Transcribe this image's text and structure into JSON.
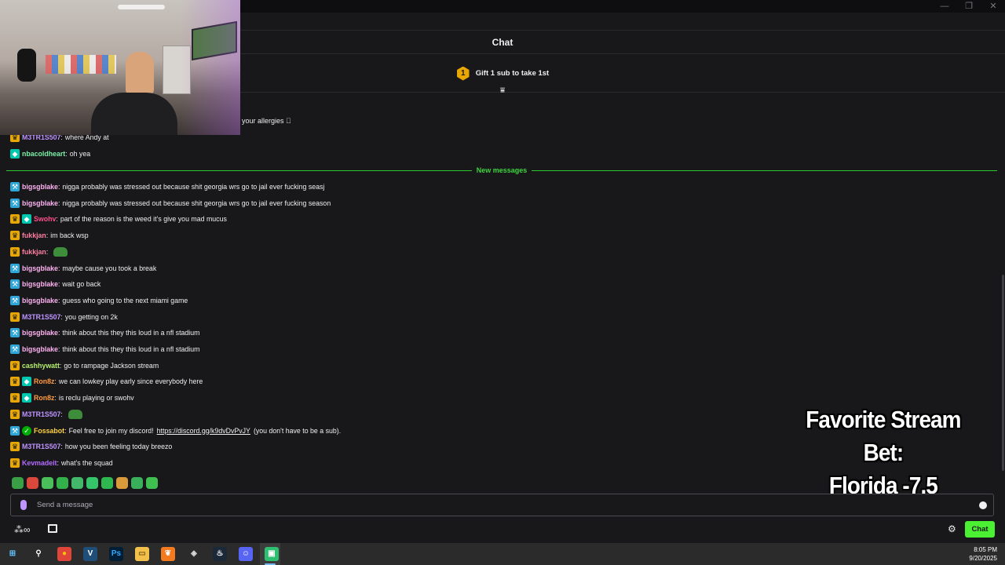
{
  "window": {
    "controls": [
      "—",
      "❐",
      "✕"
    ]
  },
  "header": {
    "title": "Chat"
  },
  "gift": {
    "rank": "1",
    "text": "Gift 1 sub to take 1st"
  },
  "partial_message": "your allergies 🏻",
  "messages_before": [
    {
      "badges": [
        "crown"
      ],
      "user": "M3TR1S507",
      "color": "#bf94ff",
      "text": "where Andy at"
    },
    {
      "badges": [
        "vip"
      ],
      "user": "nbacoldheart",
      "color": "#7bf2a6",
      "text": "oh yea"
    }
  ],
  "new_messages_label": "New messages",
  "messages": [
    {
      "badges": [
        "mod"
      ],
      "user": "bigsgblake",
      "color": "#ffb3f2",
      "text": "nigga probably was stressed out because shit georgia wrs go to jail ever fucking seasj"
    },
    {
      "badges": [
        "mod"
      ],
      "user": "bigsgblake",
      "color": "#ffb3f2",
      "text": "nigga probably was stressed out because shit georgia wrs go to jail ever fucking season"
    },
    {
      "badges": [
        "crown",
        "vip"
      ],
      "user": "Swohv",
      "color": "#ff4f8b",
      "text": "part of the reason is the weed it’s give you mad mucus"
    },
    {
      "badges": [
        "crown"
      ],
      "user": "fukkjan",
      "color": "#ff7fa1",
      "text": "im back wsp"
    },
    {
      "badges": [
        "crown"
      ],
      "user": "fukkjan",
      "color": "#ff7fa1",
      "text": "",
      "emote": "pepe-emote"
    },
    {
      "badges": [
        "mod"
      ],
      "user": "bigsgblake",
      "color": "#ffb3f2",
      "text": "maybe cause you took a break"
    },
    {
      "badges": [
        "mod"
      ],
      "user": "bigsgblake",
      "color": "#ffb3f2",
      "text": "wait go back"
    },
    {
      "badges": [
        "mod"
      ],
      "user": "bigsgblake",
      "color": "#ffb3f2",
      "text": "guess who going to the next miami game"
    },
    {
      "badges": [
        "crown"
      ],
      "user": "M3TR1S507",
      "color": "#bf94ff",
      "text": "you getting on 2k"
    },
    {
      "badges": [
        "mod"
      ],
      "user": "bigsgblake",
      "color": "#ffb3f2",
      "text": "think about this they this loud in a nfl stadium"
    },
    {
      "badges": [
        "mod"
      ],
      "user": "bigsgblake",
      "color": "#ffb3f2",
      "text": "think about this they this loud in a nfl stadium"
    },
    {
      "badges": [
        "crown"
      ],
      "user": "cashhywatt",
      "color": "#b6f06d",
      "text": "go to rampage Jackson stream"
    },
    {
      "badges": [
        "crown",
        "vip"
      ],
      "user": "Ron8z",
      "color": "#ff9b3d",
      "text": "we can lowkey play early since everybody here"
    },
    {
      "badges": [
        "crown",
        "vip"
      ],
      "user": "Ron8z",
      "color": "#ff9b3d",
      "text": "is reclu playing or swohv"
    },
    {
      "badges": [
        "crown"
      ],
      "user": "M3TR1S507",
      "color": "#bf94ff",
      "text": "",
      "emote": "gator-emote"
    },
    {
      "badges": [
        "mod",
        "verified"
      ],
      "user": "Fossabot",
      "color": "#ffd23f",
      "text": "Feel free to join my discord!",
      "link": "https://discord.gg/k9dvDvPvJY",
      "tail": "(you don't have to be a sub)."
    },
    {
      "badges": [
        "crown"
      ],
      "user": "M3TR1S507",
      "color": "#bf94ff",
      "text": "how you been feeling today breezo"
    },
    {
      "badges": [
        "crown"
      ],
      "user": "Kevmadeit",
      "color": "#b56bff",
      "text": "what's the squad"
    }
  ],
  "overlay": {
    "line1": "Favorite Stream Bet:",
    "line2": "Florida -7.5"
  },
  "input": {
    "placeholder": "Send a message"
  },
  "chat_button": "Chat",
  "emote_colors": [
    "#3aa046",
    "#d9483b",
    "#4bbf5a",
    "#32b04a",
    "#44b86a",
    "#35c46a",
    "#2fb84f",
    "#d99a3b",
    "#3ab05a",
    "#3fbf4f"
  ],
  "taskbar": {
    "time": "8:05 PM",
    "date": "9/20/2025",
    "apps": [
      "start-icon",
      "search-icon",
      "chrome-icon",
      "vegas-icon",
      "photoshop-icon",
      "file-explorer-icon",
      "fl-studio-icon",
      "app-icon",
      "steam-icon",
      "discord-icon",
      "streaming-app-icon"
    ]
  }
}
